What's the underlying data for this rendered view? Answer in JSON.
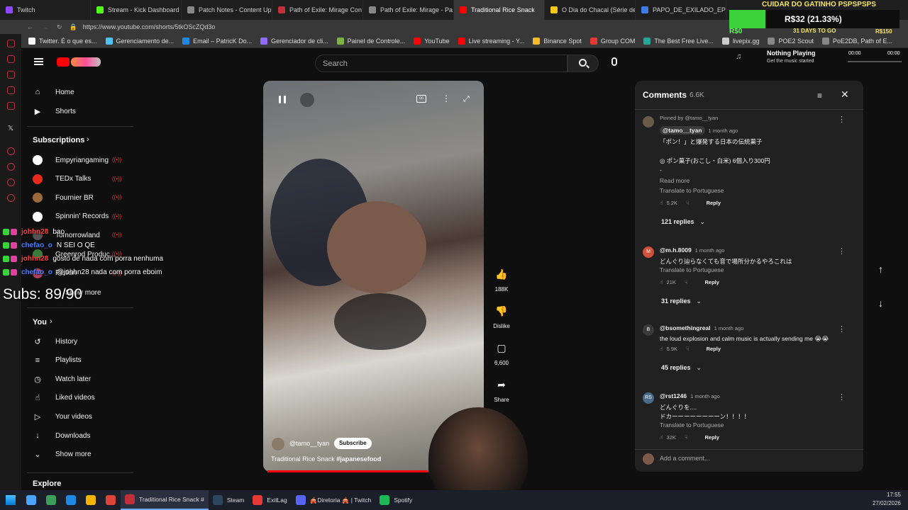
{
  "browser": {
    "tabs": [
      {
        "label": "Twitch",
        "color": "#9146ff"
      },
      {
        "label": "Stream - Kick Dashboard",
        "color": "#53fc18"
      },
      {
        "label": "Patch Notes - Content Up",
        "color": "#888888"
      },
      {
        "label": "Path of Exile: Mirage Con",
        "color": "#c0303a"
      },
      {
        "label": "Path of Exile: Mirage - Pa",
        "color": "#888888"
      },
      {
        "label": "Traditional Rice Snack",
        "color": "#ff0000",
        "active": true
      },
      {
        "label": "O Dia do Chacal (Série de",
        "color": "#f5c518"
      },
      {
        "label": "PAPO_DE_EXILADO_EP_",
        "color": "#3c7be8"
      }
    ],
    "url": "https://www.youtube.com/shorts/5tkOScZQd3o",
    "bookmarks": [
      {
        "label": "Twitter. É o que es...",
        "color": "#ffffff"
      },
      {
        "label": "Gerenciamento de...",
        "color": "#4fc3f7"
      },
      {
        "label": "Email – PatricK Do...",
        "color": "#1e88e5"
      },
      {
        "label": "Gerenciador de cli...",
        "color": "#8e6cff"
      },
      {
        "label": "Painel de Controle...",
        "color": "#7cb342"
      },
      {
        "label": "YouTube",
        "color": "#ff0000"
      },
      {
        "label": "Live streaming - Y...",
        "color": "#ff0000"
      },
      {
        "label": "Binance Spot",
        "color": "#f3ba2f"
      },
      {
        "label": "Group COM",
        "color": "#e53935"
      },
      {
        "label": "The Best Free Live...",
        "color": "#26a69a"
      },
      {
        "label": "livepix.gg",
        "color": "#cccccc"
      },
      {
        "label": "POE2 Scout",
        "color": "#888888"
      },
      {
        "label": "PoE2DB, Path of E...",
        "color": "#888888"
      }
    ]
  },
  "overlays": {
    "stream_title": "CUIDAR DO GATINHO PSPSPSPS",
    "goal_amount": "R$32 (21.33%)",
    "goal_percent": 21.33,
    "goal_min": "R$0",
    "goal_max": "R$150",
    "goal_days": "31 DAYS TO GO",
    "now_playing": "Nothing Playing",
    "now_playing_sub": "Get the music started",
    "np_time_start": "00:00",
    "np_time_end": "00:00",
    "subs": "Subs: 89/90"
  },
  "youtube": {
    "search_placeholder": "Search",
    "sidebar": {
      "top": [
        {
          "label": "Home",
          "icon": "home-icon"
        },
        {
          "label": "Shorts",
          "icon": "shorts-icon"
        }
      ],
      "subscriptions_title": "Subscriptions",
      "subscriptions": [
        {
          "label": "Empyriangaming",
          "color": "#ffffff"
        },
        {
          "label": "TEDx Talks",
          "color": "#e62b1e"
        },
        {
          "label": "Fournier BR",
          "color": "#9a6a3a"
        },
        {
          "label": "Spinnin' Records",
          "color": "#ffffff"
        },
        {
          "label": "Tomorrowland",
          "color": "#555555"
        },
        {
          "label": "Greenrod Produc...",
          "color": "#3a7a3a"
        },
        {
          "label": "Pistian",
          "color": "#b04060"
        }
      ],
      "show_more_subs": "Show more",
      "you_title": "You",
      "you_items": [
        {
          "label": "History",
          "icon": "history-icon"
        },
        {
          "label": "Playlists",
          "icon": "playlists-icon"
        },
        {
          "label": "Watch later",
          "icon": "watch-later-icon"
        },
        {
          "label": "Liked videos",
          "icon": "liked-videos-icon"
        },
        {
          "label": "Your videos",
          "icon": "your-videos-icon"
        },
        {
          "label": "Downloads",
          "icon": "downloads-icon"
        },
        {
          "label": "Show more",
          "icon": "chevron-down-icon"
        }
      ],
      "explore_title": "Explore"
    },
    "chat": [
      {
        "user": "johhn28",
        "user_color": "#ff4040",
        "msg": "bao"
      },
      {
        "user": "chefao_o",
        "user_color": "#4a7fff",
        "msg": "N SEI O QE"
      },
      {
        "user": "johhn28",
        "user_color": "#ff4040",
        "msg": "gosto de nada com porra nenhuma"
      },
      {
        "user": "chefao_o",
        "user_color": "#4a7fff",
        "msg": "@johhn28 nada com porra eboim"
      }
    ],
    "short": {
      "channel": "@tamo__tyan",
      "subscribe": "Subscribe",
      "title_plain": "Traditional Rice Snack ",
      "title_tag": "#japanesefood",
      "likes": "188K",
      "dislike": "Dislike",
      "comments": "6,600",
      "share": "Share"
    },
    "comments_panel": {
      "title": "Comments",
      "count": "6.6K",
      "add_placeholder": "Add a comment...",
      "items": [
        {
          "pinned": "Pinned by @tamo__tyan",
          "author": "@tamo__tyan",
          "time": "1 month ago",
          "lines": [
            "「ポン！」と爆発する日本の伝統菓子",
            "",
            "◎ ポン菓子(おこし・白米) 6個入り300円",
            "‐"
          ],
          "read_more": "Read more",
          "translate": "Translate to Portuguese",
          "likes": "5.2K",
          "reply": "Reply",
          "replies": "121 replies",
          "avatar_color": "#6a5a48",
          "avatar_letter": ""
        },
        {
          "author": "@m.h.8009",
          "time": "1 month ago",
          "lines": [
            "どんぐり辿らなくても音で場所分かるやろこれは"
          ],
          "translate": "Translate to Portuguese",
          "likes": "21K",
          "reply": "Reply",
          "replies": "31 replies",
          "avatar_color": "#d0503a",
          "avatar_letter": "M"
        },
        {
          "author": "@bsomethingreal",
          "time": "1 month ago",
          "lines": [
            "the loud explosion and calm music is actually sending me 😭😭"
          ],
          "likes": "5.9K",
          "reply": "Reply",
          "replies": "45 replies",
          "avatar_color": "#3a3a3a",
          "avatar_letter": "B"
        },
        {
          "author": "@rst1246",
          "time": "1 month ago",
          "lines": [
            "どんぐりを....",
            "ドカーーーーーーーーン！！！！"
          ],
          "translate": "Translate to Portuguese",
          "likes": "32K",
          "reply": "Reply",
          "avatar_color": "#4a6a8a",
          "avatar_letter": "RS"
        }
      ]
    }
  },
  "taskbar": {
    "apps": [
      {
        "label": "Traditional Rice Snack #",
        "color": "#c0303a",
        "active": true
      },
      {
        "label": "Steam",
        "color": "#2a475e"
      },
      {
        "label": "ExitLag",
        "color": "#e53935"
      },
      {
        "label": "🎪Diretoria 🎪 | Twitch",
        "color": "#5865f2"
      },
      {
        "label": "Spotify",
        "color": "#1db954"
      }
    ],
    "time": "17:55",
    "date": "27/02/2026"
  }
}
